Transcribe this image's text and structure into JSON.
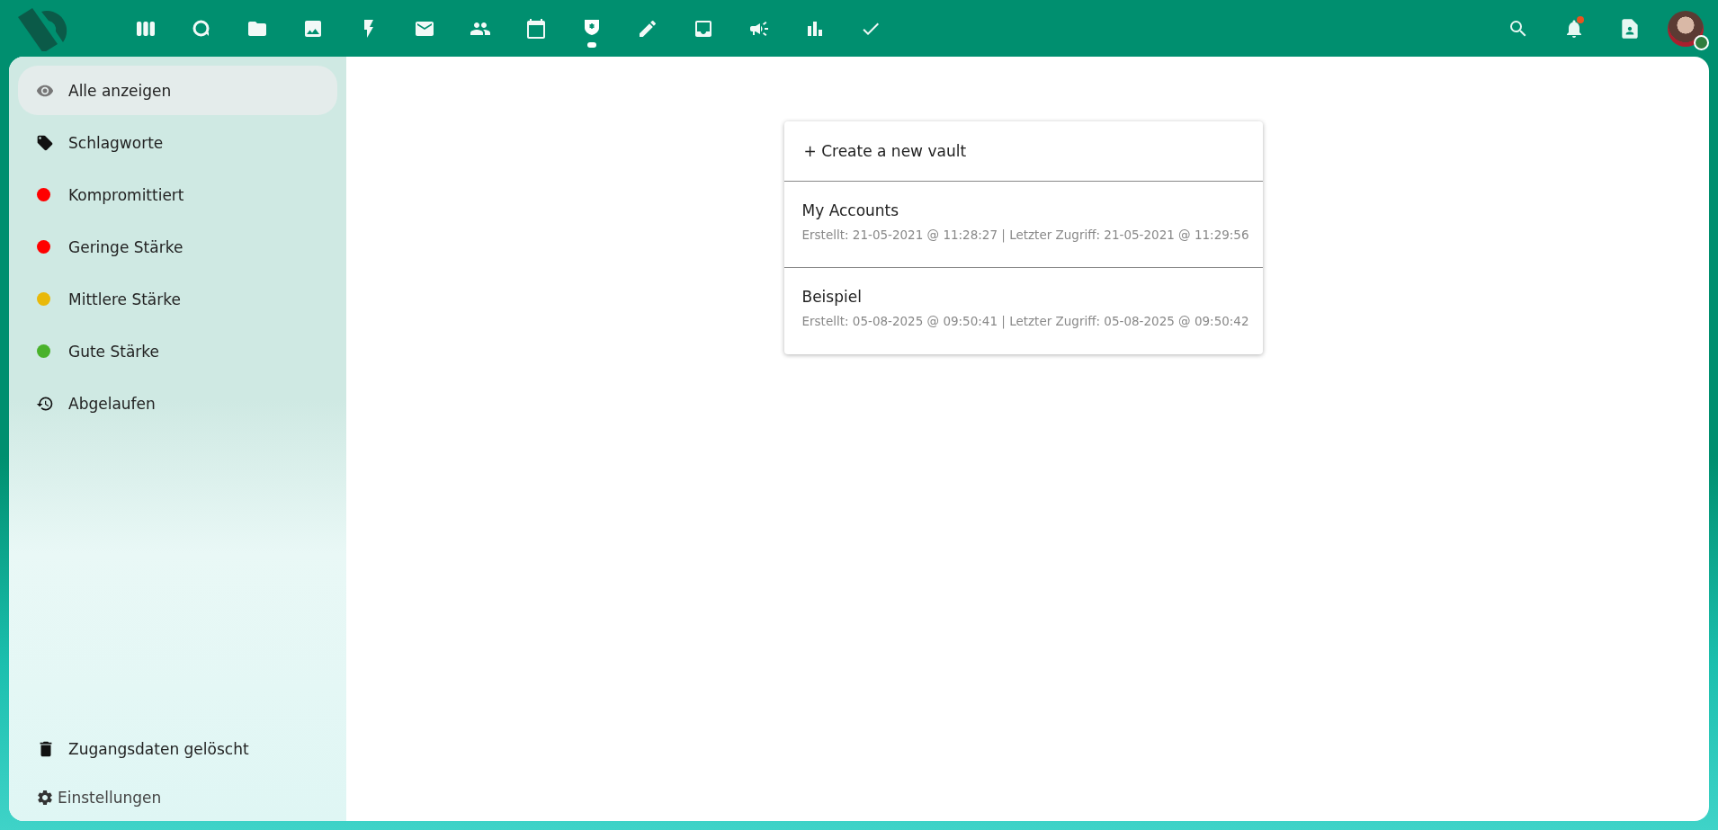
{
  "header": {
    "apps": [
      {
        "selected": false
      },
      {
        "selected": false
      },
      {
        "selected": false
      },
      {
        "selected": false
      },
      {
        "selected": false
      },
      {
        "selected": false
      },
      {
        "selected": false
      },
      {
        "selected": false
      },
      {
        "selected": true
      },
      {
        "selected": false
      },
      {
        "selected": false
      },
      {
        "selected": false
      },
      {
        "selected": false
      },
      {
        "selected": false
      }
    ],
    "notifications": {
      "unread": true
    },
    "user": {
      "online": true
    }
  },
  "sidebar": {
    "items": [
      {
        "kind": "eye",
        "label": "Alle anzeigen",
        "selected": true
      },
      {
        "kind": "tag",
        "label": "Schlagworte",
        "selected": false
      },
      {
        "kind": "dot",
        "label": "Kompromittiert",
        "selected": false,
        "color": "#ff0000"
      },
      {
        "kind": "dot",
        "label": "Geringe Stärke",
        "selected": false,
        "color": "#ff0000"
      },
      {
        "kind": "dot",
        "label": "Mittlere Stärke",
        "selected": false,
        "color": "#e9b90a"
      },
      {
        "kind": "dot",
        "label": "Gute Stärke",
        "selected": false,
        "color": "#49b22b"
      },
      {
        "kind": "history",
        "label": "Abgelaufen",
        "selected": false
      }
    ],
    "trash": {
      "label": "Zugangsdaten gelöscht"
    },
    "settings": {
      "label": "Einstellungen"
    }
  },
  "vaults": {
    "create": "+ Create a new vault",
    "items": [
      {
        "name": "My Accounts",
        "meta": "Erstellt: 21-05-2021 @ 11:28:27 | Letzter Zugriff: 21-05-2021 @ 11:29:56"
      },
      {
        "name": "Beispiel",
        "meta": "Erstellt: 05-08-2025 @ 09:50:41 | Letzter Zugriff: 05-08-2025 @ 09:50:42"
      }
    ]
  }
}
